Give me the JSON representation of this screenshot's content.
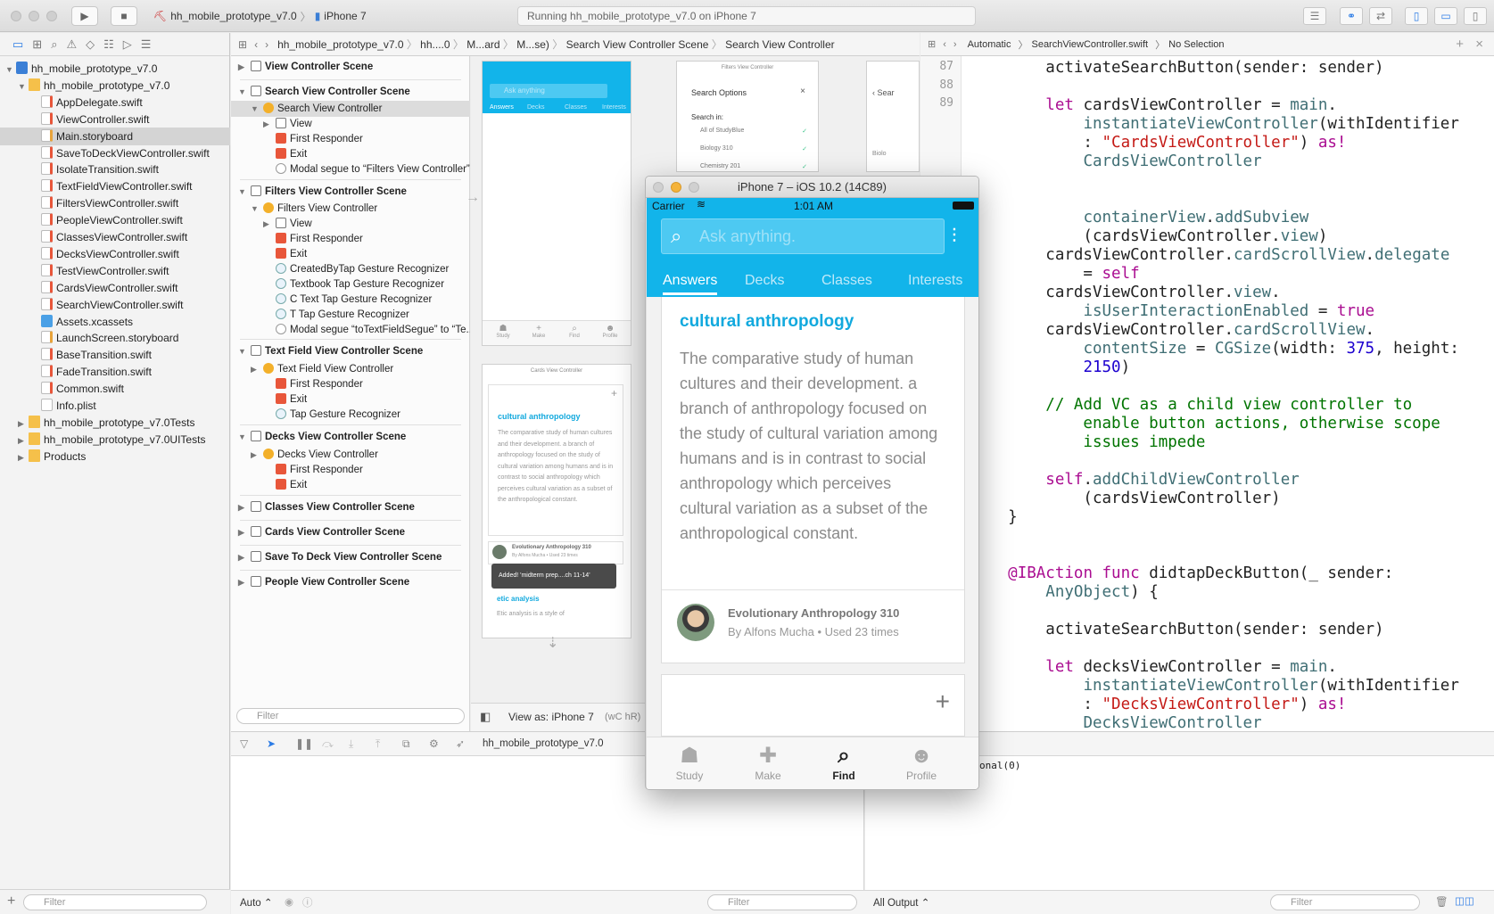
{
  "toolbar": {
    "scheme_project": "hh_mobile_prototype_v7.0",
    "scheme_device": "iPhone 7",
    "status": "Running hh_mobile_prototype_v7.0 on iPhone 7"
  },
  "navigator": {
    "items": [
      {
        "label": "hh_mobile_prototype_v7.0",
        "icon": "project-icon"
      },
      {
        "label": "hh_mobile_prototype_v7.0",
        "icon": "folder-icon"
      },
      {
        "label": "AppDelegate.swift",
        "icon": "swift-file-icon"
      },
      {
        "label": "ViewController.swift",
        "icon": "swift-file-icon"
      },
      {
        "label": "Main.storyboard",
        "icon": "storyboard-file-icon"
      },
      {
        "label": "SaveToDeckViewController.swift",
        "icon": "swift-file-icon"
      },
      {
        "label": "IsolateTransition.swift",
        "icon": "swift-file-icon"
      },
      {
        "label": "TextFieldViewController.swift",
        "icon": "swift-file-icon"
      },
      {
        "label": "FiltersViewController.swift",
        "icon": "swift-file-icon"
      },
      {
        "label": "PeopleViewController.swift",
        "icon": "swift-file-icon"
      },
      {
        "label": "ClassesViewController.swift",
        "icon": "swift-file-icon"
      },
      {
        "label": "DecksViewController.swift",
        "icon": "swift-file-icon"
      },
      {
        "label": "TestViewController.swift",
        "icon": "swift-file-icon"
      },
      {
        "label": "CardsViewController.swift",
        "icon": "swift-file-icon"
      },
      {
        "label": "SearchViewController.swift",
        "icon": "swift-file-icon"
      },
      {
        "label": "Assets.xcassets",
        "icon": "assets-icon"
      },
      {
        "label": "LaunchScreen.storyboard",
        "icon": "storyboard-file-icon"
      },
      {
        "label": "BaseTransition.swift",
        "icon": "swift-file-icon"
      },
      {
        "label": "FadeTransition.swift",
        "icon": "swift-file-icon"
      },
      {
        "label": "Common.swift",
        "icon": "swift-file-icon"
      },
      {
        "label": "Info.plist",
        "icon": "plist-file-icon"
      },
      {
        "label": "hh_mobile_prototype_v7.0Tests",
        "icon": "folder-icon"
      },
      {
        "label": "hh_mobile_prototype_v7.0UITests",
        "icon": "folder-icon"
      },
      {
        "label": "Products",
        "icon": "folder-icon"
      }
    ],
    "selected": "Main.storyboard",
    "filter_placeholder": "Filter"
  },
  "jumpbar_left": {
    "crumbs": [
      "hh_mobile_prototype_v7.0",
      "hh....0",
      "M...ard",
      "M...se)",
      "Search View Controller Scene",
      "Search View Controller"
    ]
  },
  "jumpbar_right": {
    "mode": "Automatic",
    "file": "SearchViewController.swift",
    "selection": "No Selection"
  },
  "outline": {
    "rows": [
      {
        "label": "View Controller Scene",
        "type": "scene"
      },
      {
        "label": "Search View Controller Scene",
        "type": "scene"
      },
      {
        "label": "Search View Controller",
        "type": "vc"
      },
      {
        "label": "View",
        "type": "view"
      },
      {
        "label": "First Responder",
        "type": "fr"
      },
      {
        "label": "Exit",
        "type": "exit"
      },
      {
        "label": "Modal segue to “Filters View Controller”",
        "type": "segue"
      },
      {
        "label": "Filters View Controller Scene",
        "type": "scene"
      },
      {
        "label": "Filters View Controller",
        "type": "vc"
      },
      {
        "label": "View",
        "type": "view"
      },
      {
        "label": "First Responder",
        "type": "fr"
      },
      {
        "label": "Exit",
        "type": "exit"
      },
      {
        "label": "CreatedByTap Gesture Recognizer",
        "type": "gest"
      },
      {
        "label": "Textbook Tap Gesture Recognizer",
        "type": "gest"
      },
      {
        "label": "C Text Tap Gesture Recognizer",
        "type": "gest"
      },
      {
        "label": "T Tap Gesture Recognizer",
        "type": "gest"
      },
      {
        "label": "Modal segue “toTextFieldSegue” to “Te...",
        "type": "segue"
      },
      {
        "label": "Text Field View Controller Scene",
        "type": "scene"
      },
      {
        "label": "Text Field View Controller",
        "type": "vc"
      },
      {
        "label": "First Responder",
        "type": "fr"
      },
      {
        "label": "Exit",
        "type": "exit"
      },
      {
        "label": "Tap Gesture Recognizer",
        "type": "gest"
      },
      {
        "label": "Decks View Controller Scene",
        "type": "scene"
      },
      {
        "label": "Decks View Controller",
        "type": "vc"
      },
      {
        "label": "First Responder",
        "type": "fr"
      },
      {
        "label": "Exit",
        "type": "exit"
      },
      {
        "label": "Classes View Controller Scene",
        "type": "scene"
      },
      {
        "label": "Cards View Controller Scene",
        "type": "scene"
      },
      {
        "label": "Save To Deck View Controller Scene",
        "type": "scene"
      },
      {
        "label": "People View Controller Scene",
        "type": "scene"
      }
    ],
    "filter_placeholder": "Filter"
  },
  "canvas": {
    "view_as": "View as: iPhone 7",
    "view_as_suffix": "(wC hR)",
    "mini_search_placeholder": "Ask anything",
    "mini_tabs": [
      "Answers",
      "Decks",
      "Classes",
      "Interests"
    ],
    "mini_tabbar": [
      "Study",
      "Make",
      "Find",
      "Profile"
    ],
    "filters_title": "Filters View Controller",
    "filters_header": "Search Options",
    "filters_searchin": "Search in:",
    "filters_options": [
      "All of StudyBlue",
      "Biology 310",
      "Chemistry 201"
    ],
    "cards_title": "Cards View Controller",
    "cards_term": "cultural anthropology",
    "cards_def": "The comparative study of human cultures and their development. a branch of anthropology focused on the study of cultural variation among humans and is in contrast to social anthropology which perceives cultural variation as a subset of the anthropological constant.",
    "cards_deck": "Evolutionary Anthropology 310",
    "cards_author": "By Alfons Mucha • Used 23 times",
    "cards_toast": "Added! 'midterm prep....ch 11-14'",
    "cards_term2": "etic analysis",
    "cards_def2": "Etic analysis is a style of",
    "partial_label": "Sear",
    "partial_label2": "Biolo"
  },
  "editor": {
    "line_numbers": [
      "87",
      "88",
      "89"
    ]
  },
  "debug": {
    "project": "hh_mobile_prototype_v7.0",
    "console_text": "onal(0)",
    "auto_label": "Auto",
    "filter_placeholder": "Filter",
    "output_label": "All Output"
  },
  "simulator": {
    "title": "iPhone 7 – iOS 10.2 (14C89)",
    "carrier": "Carrier",
    "time": "1:01 AM",
    "search_placeholder": "Ask anything.",
    "tabs": [
      "Answers",
      "Decks",
      "Classes",
      "Interests"
    ],
    "active_tab": "Answers",
    "term": "cultural anthropology",
    "definition": "The comparative study of human cultures and their development. a branch of anthropology focused on the study of cultural variation among humans and is in contrast to social anthropology which perceives cultural variation as a subset of the anthropological constant.",
    "deck_title": "Evolutionary Anthropology 310",
    "deck_meta": "By Alfons Mucha • Used 23 times",
    "tabbar": [
      "Study",
      "Make",
      "Find",
      "Profile"
    ],
    "active_tabbar": "Find"
  },
  "colors": {
    "accent": "#12b4ea",
    "term": "#12a9de"
  }
}
